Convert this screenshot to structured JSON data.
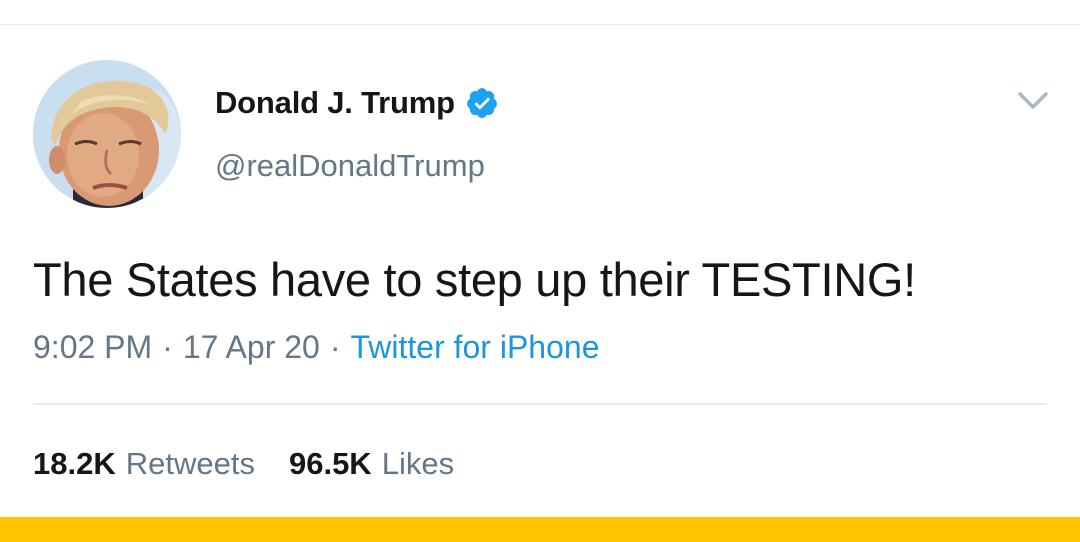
{
  "tweet": {
    "author": {
      "display_name": "Donald J. Trump",
      "handle": "@realDonaldTrump",
      "verified": true,
      "avatar_icon": "profile-photo"
    },
    "text": "The States have to step up their TESTING!",
    "time": "9:02 PM",
    "date": "17 Apr 20",
    "source": "Twitter for iPhone",
    "separator": "·",
    "stats": {
      "retweets_count": "18.2K",
      "retweets_label": "Retweets",
      "likes_count": "96.5K",
      "likes_label": "Likes"
    }
  },
  "icons": {
    "verified": "verified-badge-icon",
    "menu": "chevron-down-icon"
  },
  "colors": {
    "accent": "#1b95e0",
    "verified": "#1da1f2",
    "secondary_text": "#657786",
    "primary_text": "#14171a",
    "divider": "#e6ecf0",
    "bottom_bar": "#ffc600"
  }
}
